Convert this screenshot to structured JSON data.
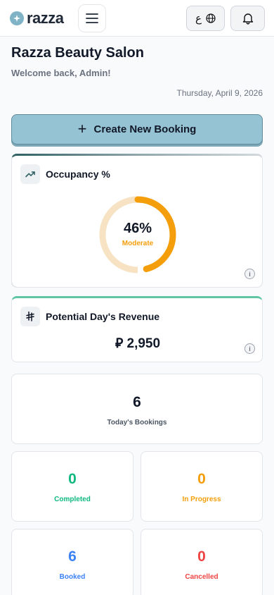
{
  "header": {
    "logo_text": "razza",
    "lang_label": "ع"
  },
  "page": {
    "title": "Razza Beauty Salon",
    "welcome": "Welcome back, Admin!",
    "date": "Thursday, April 9, 2026"
  },
  "create_button": {
    "icon": "+",
    "label": "Create New Booking"
  },
  "occupancy": {
    "title": "Occupancy %",
    "value": 0.46,
    "value_text": "46%",
    "level": "Moderate",
    "colors": {
      "fill": "#f59e0b",
      "track_teal": "#cfe9e4",
      "track_amber": "#f7e3c3"
    }
  },
  "revenue": {
    "title": "Potential Day's Revenue",
    "value": "⃁ 2,950"
  },
  "stats": {
    "total": {
      "value": "6",
      "label": "Today's Bookings"
    },
    "completed": {
      "value": "0",
      "label": "Completed",
      "color": "#10b981"
    },
    "in_progress": {
      "value": "0",
      "label": "In Progress",
      "color": "#f59e0b"
    },
    "booked": {
      "value": "6",
      "label": "Booked",
      "color": "#3b82f6"
    },
    "cancelled": {
      "value": "0",
      "label": "Cancelled",
      "color": "#ef4444"
    }
  }
}
